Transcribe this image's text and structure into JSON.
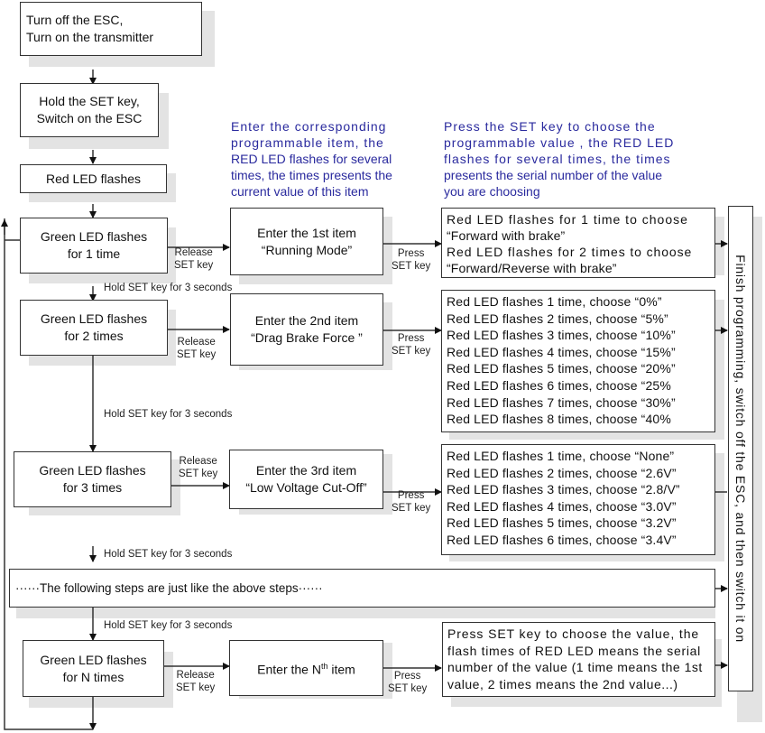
{
  "start_steps": [
    {
      "lines": [
        "Turn off the ESC,",
        "Turn on the transmitter"
      ]
    },
    {
      "lines": [
        "Hold the SET key,",
        "Switch on the ESC"
      ]
    },
    {
      "lines": [
        "Red LED flashes"
      ]
    }
  ],
  "header_notes": {
    "items_column": [
      "Enter the corresponding",
      "programmable item, the",
      "RED LED flashes for several",
      "times, the times presents the",
      "current value of this item"
    ],
    "values_column": [
      "Press the SET key to choose the",
      "programmable value , the RED LED",
      "flashes for several times, the times",
      "presents the serial number of the  value",
      "you are choosing"
    ]
  },
  "rows": [
    {
      "green": [
        "Green LED flashes",
        "for 1 time"
      ],
      "item": [
        "Enter the 1st item",
        "“Running Mode”"
      ],
      "values": [
        "Red LED flashes for 1 time to choose",
        " “Forward with brake”",
        "Red LED flashes for 2 times to  choose",
        " “Forward/Reverse with brake”"
      ]
    },
    {
      "green": [
        "Green LED flashes",
        "for 2 times"
      ],
      "item": [
        "Enter the 2nd item",
        "“Drag Brake Force ”"
      ],
      "values": [
        "Red LED flashes 1 time, choose “0%”",
        "Red LED flashes 2 times, choose “5%”",
        "Red LED flashes 3 times, choose “10%”",
        "Red LED flashes 4 times, choose “15%”",
        "Red LED flashes 5 times, choose “20%”",
        "Red LED flashes 6 times, choose “25%",
        "Red LED flashes 7 times, choose “30%”",
        "Red LED flashes 8 times, choose “40%"
      ]
    },
    {
      "green": [
        "Green LED flashes",
        "for 3 times"
      ],
      "item": [
        "Enter the 3rd item",
        "“Low Voltage Cut-Off”"
      ],
      "values": [
        "Red LED flashes 1 time, choose “None”",
        "Red LED flashes 2 times, choose “2.6V”",
        "Red LED flashes 3 times, choose “2.8/V”",
        "Red LED flashes 4 times, choose “3.0V”",
        "Red LED flashes 5 times, choose “3.2V”",
        "Red LED flashes 6 times, choose “3.4V”"
      ]
    },
    {
      "green": [
        "Green LED flashes",
        "for N times"
      ],
      "item_prefix": "Enter the N",
      "item_sup": "th",
      "item_suffix": " item",
      "values": [
        "Press SET key to choose the value, the",
        "flash times of RED LED means the serial",
        "number of the value (1 time means the 1st",
        "value, 2 times means the 2nd value...)"
      ]
    }
  ],
  "following_steps": "······The following steps are just like the above steps······",
  "labels": {
    "release_1": "Release",
    "release_2": "SET key",
    "press_1": "Press",
    "press_2": "SET key",
    "hold": "Hold SET key for 3 seconds"
  },
  "finish": "Finish programming, switch off the ESC, and then switch it on"
}
